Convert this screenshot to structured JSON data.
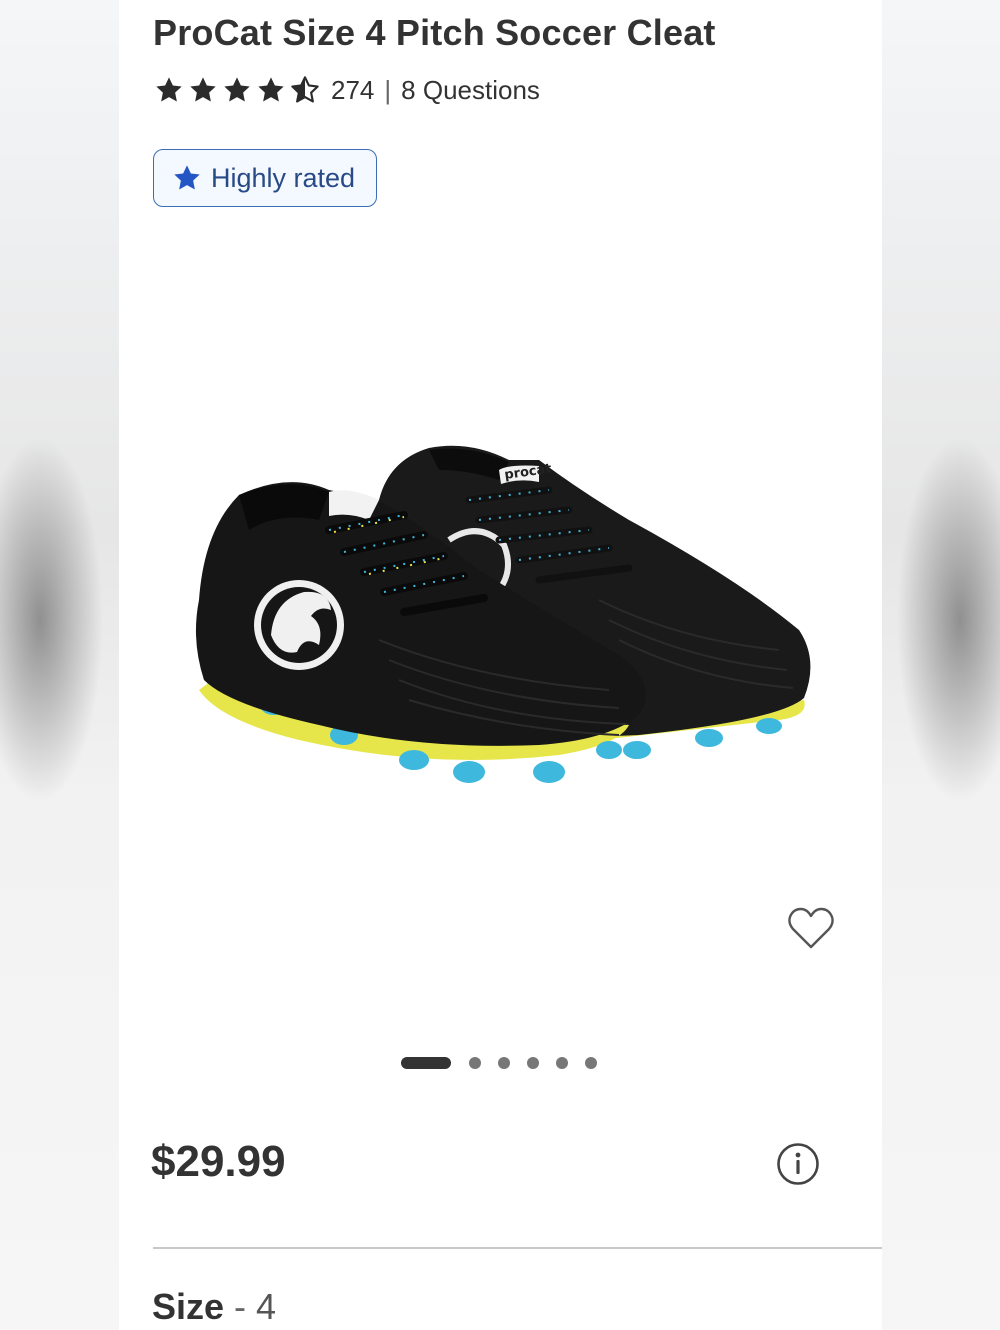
{
  "product": {
    "title": "ProCat Size 4 Pitch Soccer Cleat",
    "rating_count": "274",
    "separator": "|",
    "questions": "8 Questions",
    "rating": 4.5,
    "badge": "Highly rated",
    "price": "$29.99",
    "size_label": "Size",
    "size_dash": "-",
    "size_value": "4",
    "image_logo_text": "procat"
  },
  "carousel": {
    "total": 6,
    "active": 1
  },
  "icons": {
    "star": "star-icon",
    "half_star": "half-star-icon",
    "badge": "star-icon",
    "favorite": "heart-icon",
    "info": "info-icon"
  },
  "colors": {
    "text": "#333333",
    "badge_border": "#3d6db5",
    "badge_text": "#284a86",
    "badge_star": "#2355c4",
    "cleat_body": "#161616",
    "sole": "#e6e64a",
    "studs": "#3fb8de"
  }
}
